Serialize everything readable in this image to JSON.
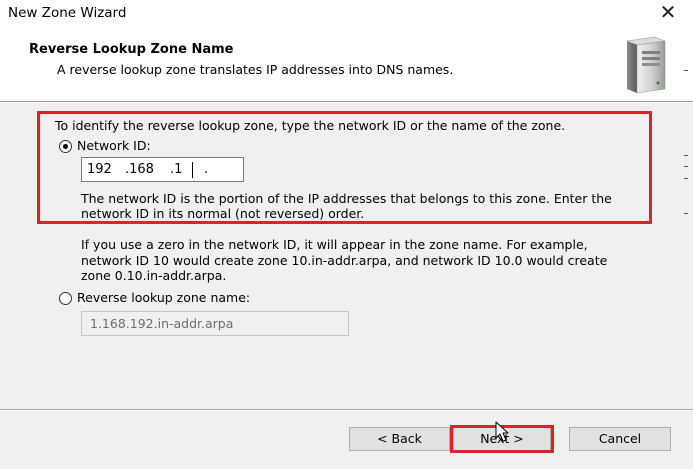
{
  "window": {
    "title": "New Zone Wizard",
    "close_glyph": "✕"
  },
  "header": {
    "title": "Reverse Lookup Zone Name",
    "subtitle": "A reverse lookup zone translates IP addresses into DNS names.",
    "icon": "server-icon"
  },
  "content": {
    "intro": "To identify the reverse lookup zone, type the network ID or the name of the zone.",
    "network_id_option": {
      "label": "Network ID:",
      "selected": true
    },
    "network_id_value": {
      "octet1": "192",
      "octet2": ".168",
      "octet3": ".1",
      "octet4": "."
    },
    "network_id_help_line1": "The network ID is the portion of the IP addresses that belongs to this zone. Enter the",
    "network_id_help_line2": "network ID in its normal (not reversed) order.",
    "zero_note_line1": "If you use a zero in the network ID, it will appear in the zone name. For example,",
    "zero_note_line2": "network ID 10 would create zone 10.in-addr.arpa, and network ID 10.0 would create",
    "zero_note_line3": "zone 0.10.in-addr.arpa.",
    "zone_name_option": {
      "label": "Reverse lookup zone name:",
      "selected": false
    },
    "zone_name_value": "1.168.192.in-addr.arpa"
  },
  "footer": {
    "back_label": "< Back",
    "next_label": "Next >",
    "cancel_label": "Cancel"
  },
  "colors": {
    "highlight_red": "#d3272c",
    "dialog_gray": "#f0f0f0"
  }
}
